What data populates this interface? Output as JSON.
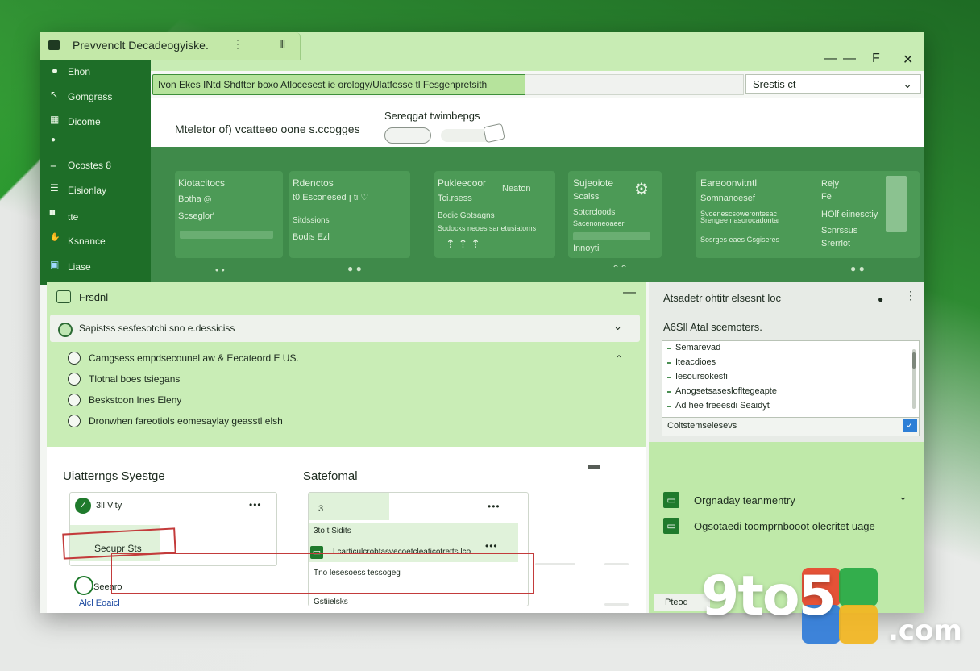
{
  "window": {
    "title": "Prevvenclt Decadeogyiske.",
    "tab_dots": "⋮",
    "tab_extra": "Ⅲ",
    "controls": [
      "—",
      "—",
      "F",
      "✕"
    ]
  },
  "sidebar": {
    "items": [
      {
        "label": "Ehon",
        "icon": "dot-icon"
      },
      {
        "label": "Gomgress",
        "icon": "pointer-icon"
      },
      {
        "label": "Dicome",
        "icon": "grid-icon"
      },
      {
        "label": "",
        "icon": "pin-icon"
      },
      {
        "label": "Ocostes 8",
        "icon": "underline-icon"
      },
      {
        "label": "Eisionlay",
        "icon": "list-icon"
      },
      {
        "label": "tte",
        "icon": "bars-icon"
      },
      {
        "label": "Ksnance",
        "icon": "hand-icon"
      },
      {
        "label": "Liase",
        "icon": "app-icon"
      }
    ]
  },
  "address": {
    "url": "Ivon Ekes INtd Shdtter boxo Atlocesest ie orology/Ulatfesse tl Fesgenpretsith",
    "search": "Srestis ct",
    "search_chevron": "⌄"
  },
  "header": {
    "subtitle": "Sereqgat twimbepgs",
    "title": "Mteletor of) vcatteeo oone s.ccogges"
  },
  "cards": [
    {
      "title": "Kiotacitocs",
      "line1": "Botha ◎",
      "line2": "Scseglor'"
    },
    {
      "title": "Rdenctos",
      "line1": "t0 Esconesed ꞁ ti ♡",
      "line2": "Sitdssions",
      "line3": "Bodis  Ezl"
    },
    {
      "title": "Pukleecoor",
      "aside": "Neaton",
      "line1": "Tci.rsess",
      "line2": "Bodic Gotsagns",
      "line3": "Sodocks neoes sanetusiatoms"
    },
    {
      "title": "Sujeoiote",
      "line1": "Scaiss",
      "line2": "Sotcrcloods",
      "line3": "Sacenoneoaeer",
      "line4": "Innoyti"
    },
    {
      "title": "Eareoonvitntl",
      "aside": "Rejy",
      "line1": "Somnanoesef",
      "line2": "Svoenescsowerontesac",
      "line3": "Srengee nasorocadontar",
      "line4": "Sosrges eaes Gsgiseres",
      "r1": "Fe",
      "r2": "HOlf eiinesctiy",
      "r3": "Scnrssus",
      "r4": "Srerrlot"
    }
  ],
  "filter_panel": {
    "title": "Frsdnl",
    "select_text": "Sapistss sesfesotchi sno e.dessiciss",
    "options": [
      "Camgsess empdsecounel aw & Eecateord E US.",
      "Tlotnal boes tsiegans",
      "Beskstoon Ines Eleny",
      "Dronwhen fareotiols eomesaylay geasstl elsh"
    ]
  },
  "lower": {
    "left_title": "Uiatterngs Syestge",
    "mid_title": "Satefomal",
    "card_left": {
      "row1": "3ll Vity",
      "row2": "Secupr Sts",
      "row3": "Seearo",
      "row4": "Alcl Eoaicl"
    },
    "card_mid": {
      "row0": "3",
      "row1": "3to t Sidits",
      "row2": "Lcarticulcrobtasvecoetcleaticotretts lco",
      "row3": "Tno lesesoess tessogeg",
      "row4": "Gstiielsks"
    }
  },
  "right_panel": {
    "title": "Atsadetr ohtitr elsesnt loc",
    "subtitle": "A6Sll Atal scemoters.",
    "list": [
      "Semarevad",
      "Iteacdioes",
      "Iesoursokesfi",
      "Anogsetsaseslofltegeapte",
      "Ad hee freeesdi Seaidyt"
    ],
    "footer": "Coltstemselesevs",
    "items": [
      "Orgnaday teanmentry",
      "Ogsotaedi toomprnbooot olecritet uage"
    ],
    "bottom": "Pteod"
  },
  "watermark": {
    "brand": "9to5",
    "suffix": ".com"
  },
  "colors": {
    "accent": "#1f7a2c",
    "panel": "#c9edb6",
    "band": "#3f8a4a",
    "alert": "#c33b3b"
  }
}
